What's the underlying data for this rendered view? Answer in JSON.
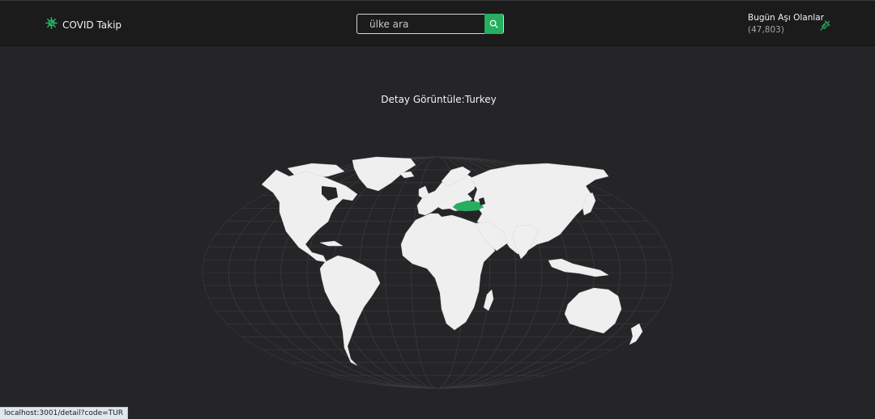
{
  "navbar": {
    "brand_text": "COVID Takip",
    "search_placeholder": "ülke ara",
    "vaccination_label": "Bugün Aşı Olanlar",
    "vaccination_count": "(47,803)"
  },
  "detail": {
    "title": "Detay Görüntüle:Turkey",
    "selected_country_code": "TUR"
  },
  "status_bar": {
    "url": "localhost:3001/detail?code=TUR"
  },
  "colors": {
    "background": "#252527",
    "navbar": "#1b1b1c",
    "accent": "#27ae60",
    "land": "#efefef",
    "graticule": "#3c3c3f"
  },
  "icons": {
    "brand": "virus-icon",
    "search": "search-icon",
    "vaccination": "syringe-icon"
  }
}
